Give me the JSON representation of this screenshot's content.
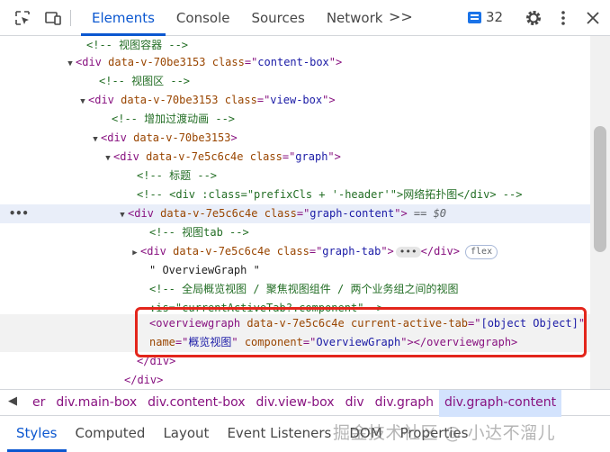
{
  "toolbar": {
    "tabs": [
      "Elements",
      "Console",
      "Sources",
      "Network"
    ],
    "more_tabs": ">>",
    "messages_count": "32"
  },
  "tree": {
    "rows": [
      {
        "parts": [
          [
            "cm",
            "<!-- 视图容器 -->"
          ]
        ]
      },
      {
        "parts": [
          [
            "tag",
            "<div "
          ],
          [
            "an",
            "data-v-70be3153 class"
          ],
          [
            "tag",
            "=\""
          ],
          [
            "av",
            "content-box"
          ],
          [
            "tag",
            "\">"
          ]
        ]
      },
      {
        "parts": [
          [
            "cm",
            "<!-- 视图区 -->"
          ]
        ]
      },
      {
        "parts": [
          [
            "tag",
            "<div "
          ],
          [
            "an",
            "data-v-70be3153 class"
          ],
          [
            "tag",
            "=\""
          ],
          [
            "av",
            "view-box"
          ],
          [
            "tag",
            "\">"
          ]
        ]
      },
      {
        "parts": [
          [
            "cm",
            "<!-- 增加过渡动画 -->"
          ]
        ]
      },
      {
        "parts": [
          [
            "tag",
            "<div "
          ],
          [
            "an",
            "data-v-70be3153"
          ],
          [
            "tag",
            ">"
          ]
        ]
      },
      {
        "parts": [
          [
            "tag",
            "<div "
          ],
          [
            "an",
            "data-v-7e5c6c4e class"
          ],
          [
            "tag",
            "=\""
          ],
          [
            "av",
            "graph"
          ],
          [
            "tag",
            "\">"
          ]
        ]
      },
      {
        "parts": [
          [
            "cm",
            "<!-- 标题 -->"
          ]
        ]
      },
      {
        "parts": [
          [
            "cm",
            "<!-- <div :class=\"prefixCls + '-header'\">网络拓扑图</div> -->"
          ]
        ]
      },
      {
        "parts": [
          [
            "tag",
            "<div "
          ],
          [
            "an",
            "data-v-7e5c6c4e class"
          ],
          [
            "tag",
            "=\""
          ],
          [
            "av",
            "graph-content"
          ],
          [
            "tag",
            "\">"
          ],
          [
            "dim",
            " == $0"
          ]
        ]
      },
      {
        "parts": [
          [
            "cm",
            "<!-- 视图tab -->"
          ]
        ]
      },
      {
        "parts": [
          [
            "tag",
            "<div "
          ],
          [
            "an",
            "data-v-7e5c6c4e class"
          ],
          [
            "tag",
            "=\""
          ],
          [
            "av",
            "graph-tab"
          ],
          [
            "tag",
            "\">"
          ]
        ]
      },
      {
        "parts": [
          [
            "txt",
            "\" OverviewGraph \""
          ]
        ]
      },
      {
        "parts": [
          [
            "cm",
            "<!-- 全局概览视图 / 聚焦视图组件 / 两个业务组之间的视图"
          ]
        ]
      },
      {
        "parts": [
          [
            "cm",
            ":is=\"currentActiveTab?.component\"-->"
          ]
        ]
      },
      {
        "parts": [
          [
            "tag",
            "<overviewgraph "
          ],
          [
            "an",
            "data-v-7e5c6c4e current-active-tab"
          ],
          [
            "tag",
            "=\""
          ],
          [
            "av",
            "[object Object]"
          ],
          [
            "tag",
            "\""
          ]
        ]
      },
      {
        "parts": [
          [
            "an",
            "name"
          ],
          [
            "tag",
            "=\""
          ],
          [
            "av",
            "概览视图"
          ],
          [
            "tag",
            "\" "
          ],
          [
            "an",
            "component"
          ],
          [
            "tag",
            "=\""
          ],
          [
            "av",
            "OverviewGraph"
          ],
          [
            "tag",
            "\"></overviewgraph>"
          ]
        ]
      },
      {
        "parts": [
          [
            "tag",
            "</div>"
          ]
        ]
      },
      {
        "parts": [
          [
            "tag",
            "</div>"
          ]
        ]
      }
    ],
    "graph_tab_close": "</div>",
    "ellipsis": "•••",
    "flex_badge": "flex",
    "dots": "•••"
  },
  "breadcrumbs": {
    "arrow": "◀",
    "items": [
      "er",
      "div.main-box",
      "div.content-box",
      "div.view-box",
      "div",
      "div.graph",
      "div.graph-content"
    ],
    "active_index": 6
  },
  "bottom_tabs": [
    "Styles",
    "Computed",
    "Layout",
    "Event Listeners",
    "DOM",
    "Properties"
  ],
  "watermark": "掘金技术社区 @ 小达不溜儿",
  "colors": {
    "accent": "#0b57d0",
    "tag": "#881280",
    "attr_name": "#994500",
    "attr_value": "#1a1aa6",
    "comment": "#236e25",
    "highlight_box": "#e3261c"
  }
}
